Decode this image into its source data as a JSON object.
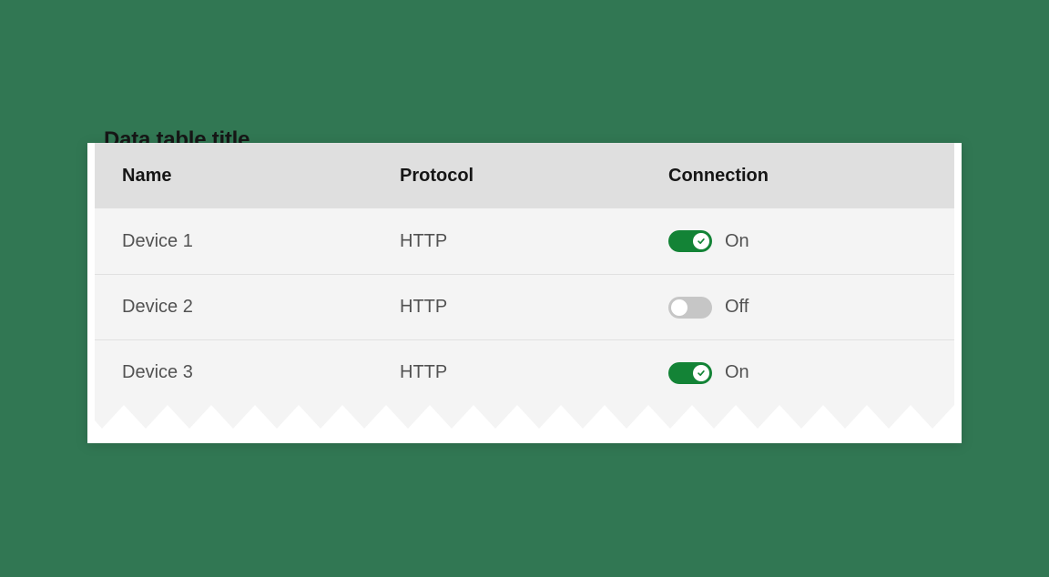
{
  "title": "Data table title",
  "columns": {
    "name": "Name",
    "protocol": "Protocol",
    "connection": "Connection"
  },
  "labels": {
    "on": "On",
    "off": "Off"
  },
  "colors": {
    "toggle_on": "#138336",
    "toggle_off": "#c6c6c6"
  },
  "rows": [
    {
      "name": "Device 1",
      "protocol": "HTTP",
      "connection": true
    },
    {
      "name": "Device 2",
      "protocol": "HTTP",
      "connection": false
    },
    {
      "name": "Device 3",
      "protocol": "HTTP",
      "connection": true
    }
  ]
}
